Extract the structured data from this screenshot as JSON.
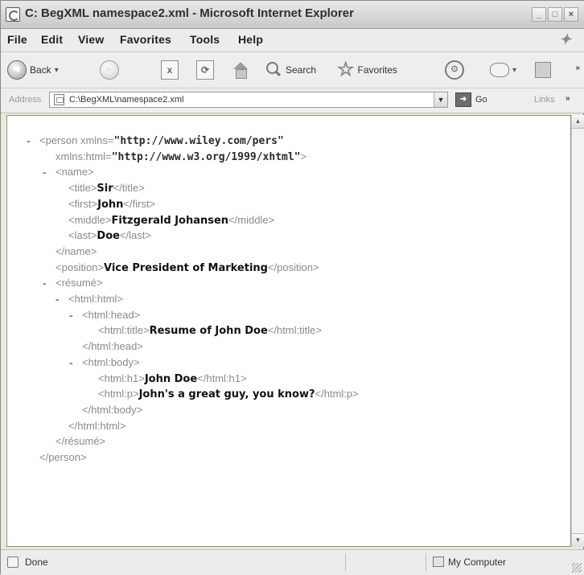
{
  "window": {
    "title": "C: BegXML namespace2.xml - Microsoft Internet Explorer",
    "buttons": {
      "minimize": "_",
      "maximize": "□",
      "close": "×"
    }
  },
  "menubar": {
    "items": [
      "File",
      "Edit",
      "View",
      "Favorites",
      "Tools",
      "Help"
    ]
  },
  "toolbar": {
    "back_label": "Back",
    "search_label": "Search",
    "favorites_label": "Favorites",
    "overflow": "»"
  },
  "addressbar": {
    "label": "Address",
    "value": "C:\\BegXML\\namespace2.xml",
    "go_label": "Go",
    "links_label": "Links",
    "links_overflow": "»"
  },
  "document": {
    "lines": [
      {
        "minus": "-",
        "pre": "<person xmlns=",
        "val": "\"http://www.wiley.com/pers\"",
        "post": ""
      },
      {
        "minus": "",
        "pre": "xmlns:html=",
        "val": "\"http://www.w3.org/1999/xhtml\"",
        "post": ">"
      },
      {
        "minus": "-",
        "pre": "<name>",
        "val": "",
        "post": ""
      },
      {
        "minus": "",
        "pre": "<title>",
        "val": "Sir",
        "post": "</title>"
      },
      {
        "minus": "",
        "pre": "<first>",
        "val": "John",
        "post": "</first>"
      },
      {
        "minus": "",
        "pre": "<middle>",
        "val": "Fitzgerald Johansen",
        "post": "</middle>"
      },
      {
        "minus": "",
        "pre": "<last>",
        "val": "Doe",
        "post": "</last>"
      },
      {
        "minus": "",
        "pre": "</name>",
        "val": "",
        "post": ""
      },
      {
        "minus": "",
        "pre": "<position>",
        "val": "Vice President of Marketing",
        "post": "</position>"
      },
      {
        "minus": "-",
        "pre": "<résumé>",
        "val": "",
        "post": ""
      },
      {
        "minus": "-",
        "pre": "<html:html>",
        "val": "",
        "post": ""
      },
      {
        "minus": "-",
        "pre": "<html:head>",
        "val": "",
        "post": ""
      },
      {
        "minus": "",
        "pre": "<html:title>",
        "val": "Resume of John Doe",
        "post": "</html:title>"
      },
      {
        "minus": "",
        "pre": "</html:head>",
        "val": "",
        "post": ""
      },
      {
        "minus": "-",
        "pre": "<html:body>",
        "val": "",
        "post": ""
      },
      {
        "minus": "",
        "pre": "<html:h1>",
        "val": "John Doe",
        "post": "</html:h1>"
      },
      {
        "minus": "",
        "pre": "<html:p>",
        "val": "John's a great guy, you know?",
        "post": "</html:p>"
      },
      {
        "minus": "",
        "pre": "</html:body>",
        "val": "",
        "post": ""
      },
      {
        "minus": "",
        "pre": "</html:html>",
        "val": "",
        "post": ""
      },
      {
        "minus": "",
        "pre": "</résumé>",
        "val": "",
        "post": ""
      },
      {
        "minus": "",
        "pre": "</person>",
        "val": "",
        "post": ""
      }
    ]
  },
  "statusbar": {
    "status": "Done",
    "zone": "My Computer"
  }
}
